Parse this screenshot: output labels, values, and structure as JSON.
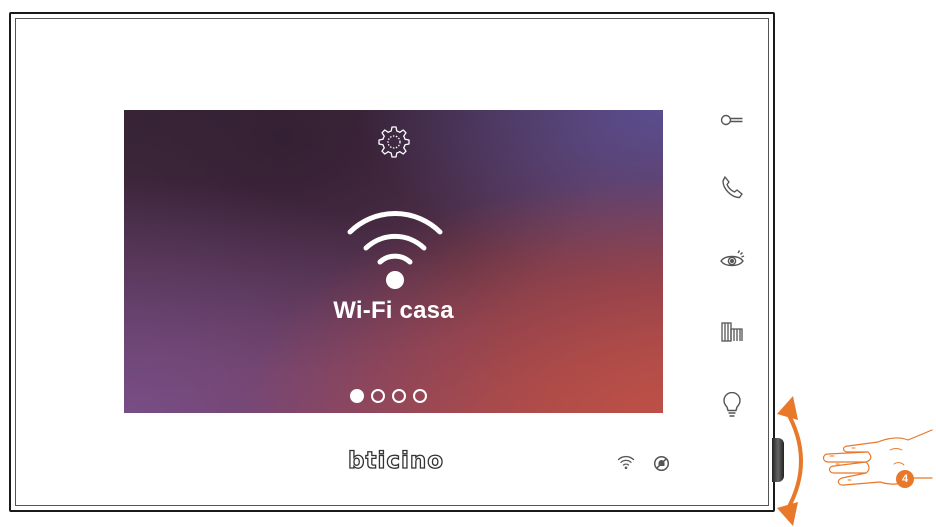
{
  "screen": {
    "network_name": "Wi-Fi casa",
    "settings_icon": "gear-icon",
    "wifi_icon": "wifi-icon",
    "pager": {
      "total_pages": 4,
      "active_page": 1
    }
  },
  "side_buttons": [
    {
      "name": "door-lock-key-icon"
    },
    {
      "name": "phone-handset-icon"
    },
    {
      "name": "eye-camera-icon"
    },
    {
      "name": "gate-icon"
    },
    {
      "name": "light-bulb-icon"
    }
  ],
  "brand": {
    "logo_text": "bticino"
  },
  "status_bar": {
    "wifi_icon": "wifi-icon",
    "dnd_icon": "do-not-disturb-icon"
  },
  "annotation": {
    "step_number": "4",
    "accent_color": "#e8792a",
    "gesture": "rotate-dial"
  },
  "colors": {
    "screen_dark": "#3a2738",
    "screen_warm": "#a04a4e",
    "icon_gray": "#555555"
  }
}
